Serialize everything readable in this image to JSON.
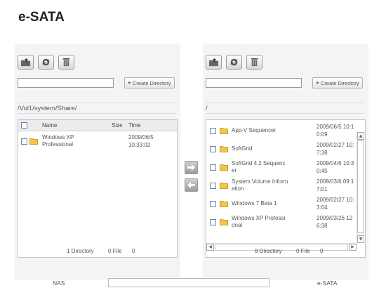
{
  "page": {
    "title": "e-SATA"
  },
  "left_panel": {
    "dir_input_value": "",
    "create_button": "Create Directory",
    "path": "/Vol1/system/Share/",
    "columns": {
      "name": "Name",
      "size": "Size",
      "time": "Time"
    },
    "rows": [
      {
        "name_l1": "Windows XP",
        "name_l2": "Professional",
        "time_l1": "2009/06/5",
        "time_l2": "10:33:02"
      }
    ],
    "summary": {
      "dirs": "1 Directory",
      "files": "0 File",
      "size": "0"
    }
  },
  "right_panel": {
    "dir_input_value": "",
    "create_button": "Create Directory",
    "path": "/",
    "rows": [
      {
        "name_l1": "App-V Sequencer",
        "name_l2": "",
        "time_l1": "2009/06/5 10:1",
        "time_l2": "0:09"
      },
      {
        "name_l1": "SoftGrid",
        "name_l2": "",
        "time_l1": "2009/02/27 10:",
        "time_l2": "7:38"
      },
      {
        "name_l1": "SoftGrid 4.2 Sequenc",
        "name_l2": "er",
        "time_l1": "2009/04/6 10:3",
        "time_l2": "0:45"
      },
      {
        "name_l1": "System Volume Inform",
        "name_l2": "ation",
        "time_l1": "2009/03/6 09:1",
        "time_l2": "7:01"
      },
      {
        "name_l1": "Windows 7 Beta 1",
        "name_l2": "",
        "time_l1": "2009/02/27 10:",
        "time_l2": "3:04"
      },
      {
        "name_l1": "Windows XP Professi",
        "name_l2": "onal",
        "time_l1": "2009/03/26 12",
        "time_l2": "6:38"
      }
    ],
    "summary": {
      "dirs": "8 Directory",
      "files": "0 File",
      "size": "0"
    }
  },
  "footer": {
    "left_label": "NAS",
    "right_label": "e-SATA",
    "progress_value": ""
  },
  "icons": {
    "toolbar": [
      "upload-folder-icon",
      "refresh-icon",
      "trash-icon"
    ],
    "transfer": [
      "arrow-right-icon",
      "arrow-left-icon"
    ]
  },
  "colors": {
    "folder": "#f2c744",
    "checkbox_border": "#6d86aa",
    "panel_bg": "#f4f4f4"
  }
}
